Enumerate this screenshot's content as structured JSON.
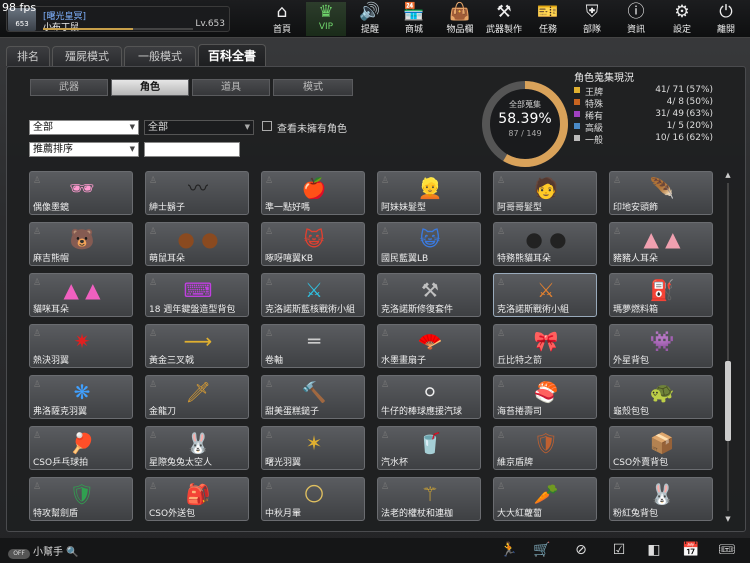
{
  "fps": "98 fps",
  "profile": {
    "clan": "[曙光皇冥]",
    "name": "小布丁鼠",
    "level": "Lv.653",
    "avatar_code": "653"
  },
  "nav": [
    {
      "label": "首頁",
      "icon": "home-icon",
      "glyph": "⌂"
    },
    {
      "label": "VIP",
      "icon": "crown-icon",
      "glyph": "♛"
    },
    {
      "label": "提醒",
      "icon": "speaker-icon",
      "glyph": "🔊"
    },
    {
      "label": "商城",
      "icon": "shop-icon",
      "glyph": "🏪"
    },
    {
      "label": "物品欄",
      "icon": "bag-icon",
      "glyph": "👜"
    },
    {
      "label": "武器製作",
      "icon": "craft-icon",
      "glyph": "⚒"
    },
    {
      "label": "任務",
      "icon": "ticket-icon",
      "glyph": "🎫"
    },
    {
      "label": "部隊",
      "icon": "shield-icon",
      "glyph": "⛨"
    },
    {
      "label": "資訊",
      "icon": "info-icon",
      "glyph": "ⓘ"
    },
    {
      "label": "設定",
      "icon": "gear-icon",
      "glyph": "⚙"
    },
    {
      "label": "離開",
      "icon": "power-icon",
      "glyph": "⏻"
    }
  ],
  "tabs": [
    "排名",
    "殭屍模式",
    "一般模式",
    "百科全書"
  ],
  "subtabs": [
    "武器",
    "角色",
    "道具",
    "模式"
  ],
  "filters": {
    "category": "全部",
    "category2": "全部",
    "sort": "推薦排序",
    "search": ""
  },
  "checkbox_label": "查看未擁有角色",
  "gauge": {
    "title": "全部蒐集",
    "percent": "58.39%",
    "count": "87 / 149",
    "fraction": 0.5839
  },
  "stats_title": "角色蒐集現況",
  "stats": [
    {
      "name": "王牌",
      "count": "41/ 71",
      "pct": "(57%)",
      "color": "#e0b030"
    },
    {
      "name": "特殊",
      "count": "4/ 8",
      "pct": "(50%)",
      "color": "#c86420"
    },
    {
      "name": "稀有",
      "count": "31/ 49",
      "pct": "(63%)",
      "color": "#a040c0"
    },
    {
      "name": "高級",
      "count": "1/ 5",
      "pct": "(20%)",
      "color": "#4a8ac8"
    },
    {
      "name": "一般",
      "count": "10/ 16",
      "pct": "(62%)",
      "color": "#bbbbbb"
    }
  ],
  "items": [
    {
      "name": "偶像墨鏡",
      "glyph": "🕶",
      "color": "#ff9ad0"
    },
    {
      "name": "紳士鬍子",
      "glyph": "〰",
      "color": "#222"
    },
    {
      "name": "準一點好嗎",
      "glyph": "🍎",
      "color": "#e03030"
    },
    {
      "name": "阿妹妹髮型",
      "glyph": "👱",
      "color": "#e0b060"
    },
    {
      "name": "阿哥哥髮型",
      "glyph": "🧑",
      "color": "#8a4a2a"
    },
    {
      "name": "印地安頭飾",
      "glyph": "🪶",
      "color": "#c07040"
    },
    {
      "name": "麻吉熊帽",
      "glyph": "🐻",
      "color": "#eeeeee"
    },
    {
      "name": "萌鼠耳朵",
      "glyph": "● ●",
      "color": "#8a4a20"
    },
    {
      "name": "啄呀嘻翼KB",
      "glyph": "😺",
      "color": "#e04030"
    },
    {
      "name": "國民藍翼LB",
      "glyph": "😺",
      "color": "#3a7ae0"
    },
    {
      "name": "特務熊貓耳朵",
      "glyph": "● ●",
      "color": "#222"
    },
    {
      "name": "豬豬人耳朵",
      "glyph": "▲ ▲",
      "color": "#f0a0b0"
    },
    {
      "name": "貓咪耳朵",
      "glyph": "▲ ▲",
      "color": "#f060c0"
    },
    {
      "name": "18 週年鍵盤造型背包",
      "glyph": "⌨",
      "color": "#c040e0"
    },
    {
      "name": "克洛諾斯藍核戰術小組",
      "glyph": "⚔",
      "color": "#30c0e0"
    },
    {
      "name": "克洛諾斯修復套件",
      "glyph": "⚒",
      "color": "#c0c0c0"
    },
    {
      "name": "克洛諾斯戰術小組",
      "glyph": "⚔",
      "color": "#e08030"
    },
    {
      "name": "瑪夢燃料箱",
      "glyph": "⛽",
      "color": "#e0c070"
    },
    {
      "name": "熱決羽翼",
      "glyph": "✷",
      "color": "#e02020"
    },
    {
      "name": "黃金三叉戟",
      "glyph": "⟶",
      "color": "#e0b030"
    },
    {
      "name": "卷軸",
      "glyph": "═",
      "color": "#cccccc"
    },
    {
      "name": "水墨畫扇子",
      "glyph": "🪭",
      "color": "#e0e0e0"
    },
    {
      "name": "丘比特之箭",
      "glyph": "🎀",
      "color": "#e03050"
    },
    {
      "name": "外星背包",
      "glyph": "👾",
      "color": "#30b0e0"
    },
    {
      "name": "弗洛薩克羽翼",
      "glyph": "❋",
      "color": "#40a0ff"
    },
    {
      "name": "金龍刀",
      "glyph": "🗡",
      "color": "#e0a030"
    },
    {
      "name": "甜美蛋糕鎚子",
      "glyph": "🔨",
      "color": "#e0a0c0"
    },
    {
      "name": "牛仔的棒球應援汽球",
      "glyph": "⚪",
      "color": "#eeeeee"
    },
    {
      "name": "海苔捲壽司",
      "glyph": "🍣",
      "color": "#e0a030"
    },
    {
      "name": "龜殼包包",
      "glyph": "🐢",
      "color": "#50a030"
    },
    {
      "name": "CSO乒乓球拍",
      "glyph": "🏓",
      "color": "#e03030"
    },
    {
      "name": "星際兔兔太空人",
      "glyph": "🐰",
      "color": "#f080c0"
    },
    {
      "name": "曙光羽翼",
      "glyph": "✶",
      "color": "#e0b030"
    },
    {
      "name": "汽水杯",
      "glyph": "🥤",
      "color": "#3a7ae0"
    },
    {
      "name": "維京盾牌",
      "glyph": "🛡",
      "color": "#c06030"
    },
    {
      "name": "CSO外賣背包",
      "glyph": "📦",
      "color": "#dddddd"
    },
    {
      "name": "特攻幫劍盾",
      "glyph": "🛡",
      "color": "#30a050"
    },
    {
      "name": "CSO外送包",
      "glyph": "🎒",
      "color": "#e0c040"
    },
    {
      "name": "中秋月暈",
      "glyph": "🌕",
      "color": "#e0c060"
    },
    {
      "name": "法老的權杖和連枷",
      "glyph": "⚚",
      "color": "#e0b030"
    },
    {
      "name": "大大紅蘿蔔",
      "glyph": "🥕",
      "color": "#f07020"
    },
    {
      "name": "粉紅兔背包",
      "glyph": "🐰",
      "color": "#f0a0c0"
    }
  ],
  "bottom": {
    "helper_label": "小幫手",
    "toggle_label": "OFF",
    "icons": [
      "run-icon",
      "cart-icon",
      "compass-icon",
      "checklist-icon",
      "book-icon",
      "calendar-icon",
      "ticket-icon"
    ],
    "glyphs": [
      "🏃",
      "🛒",
      "⊘",
      "☑",
      "◧",
      "📅",
      "🎟"
    ]
  }
}
